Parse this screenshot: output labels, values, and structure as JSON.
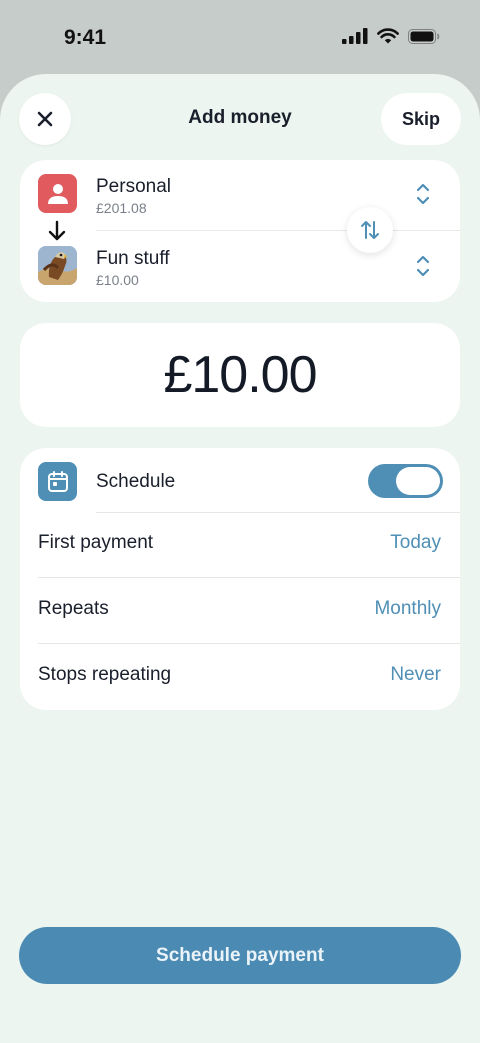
{
  "status_bar": {
    "time": "9:41"
  },
  "nav": {
    "title": "Add money",
    "skip_label": "Skip"
  },
  "accounts": {
    "from": {
      "name": "Personal",
      "balance": "£201.08"
    },
    "to": {
      "name": "Fun stuff",
      "balance": "£10.00"
    }
  },
  "amount": {
    "value": "£10.00"
  },
  "schedule": {
    "label": "Schedule",
    "enabled": true,
    "rows": [
      {
        "label": "First payment",
        "value": "Today"
      },
      {
        "label": "Repeats",
        "value": "Monthly"
      },
      {
        "label": "Stops repeating",
        "value": "Never"
      }
    ]
  },
  "primary_action": {
    "label": "Schedule payment"
  },
  "colors": {
    "accent": "#4a8ab3",
    "sheet_background": "#ecf5ef",
    "personal_avatar": "#e05a5e"
  },
  "icons": [
    "close-icon",
    "swap-icon",
    "chevron-updown-icon",
    "calendar-icon",
    "person-icon",
    "arrow-down-icon"
  ]
}
